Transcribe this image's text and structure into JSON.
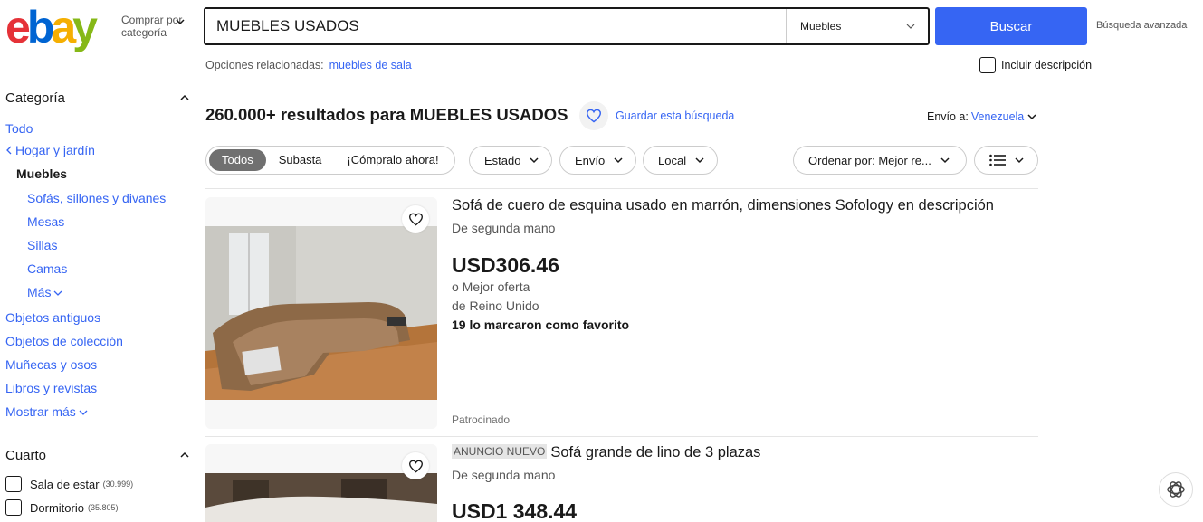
{
  "header": {
    "logo": [
      "e",
      "b",
      "a",
      "y"
    ],
    "shop_by_category": "Comprar por categoría",
    "search_value": "MUEBLES USADOS",
    "search_category": "Muebles",
    "search_button": "Buscar",
    "advanced_search": "Búsqueda avanzada",
    "related_label": "Opciones relacionadas:",
    "related_link": "muebles de sala",
    "include_description": "Incluir descripción"
  },
  "sidebar": {
    "category_title": "Categoría",
    "category_items": [
      {
        "label": "Todo"
      },
      {
        "label": "Hogar y jardín"
      },
      {
        "label": "Muebles"
      },
      {
        "label": "Sofás, sillones y divanes"
      },
      {
        "label": "Mesas"
      },
      {
        "label": "Sillas"
      },
      {
        "label": "Camas"
      },
      {
        "label": "Más"
      },
      {
        "label": "Objetos antiguos"
      },
      {
        "label": "Objetos de colección"
      },
      {
        "label": "Muñecas y osos"
      },
      {
        "label": "Libros y revistas"
      },
      {
        "label": "Mostrar más"
      }
    ],
    "room_title": "Cuarto",
    "room_items": [
      {
        "label": "Sala de estar",
        "count": "(30.999)"
      },
      {
        "label": "Dormitorio",
        "count": "(35.805)"
      }
    ]
  },
  "results": {
    "count_text": "260.000+ resultados para MUEBLES USADOS",
    "save_search": "Guardar esta búsqueda",
    "ship_to_label": "Envío a:",
    "ship_to_value": "Venezuela"
  },
  "filters": {
    "segments": [
      "Todos",
      "Subasta",
      "¡Cómpralo ahora!"
    ],
    "dropdowns": [
      "Estado",
      "Envío",
      "Local"
    ],
    "sort": "Ordenar por: Mejor re...",
    "view_icon": "list-view-icon"
  },
  "items": [
    {
      "badge": "",
      "title": "Sofá de cuero de esquina usado en marrón, dimensiones Sofology en descripción",
      "condition": "De segunda mano",
      "price": "USD306.46",
      "best_offer": "o Mejor oferta",
      "origin": "de Reino Unido",
      "watchers": "19 lo marcaron como favorito",
      "sponsored": "Patrocinado"
    },
    {
      "badge": "ANUNCIO NUEVO",
      "title": "Sofá grande de lino de 3 plazas",
      "condition": "De segunda mano",
      "price": "USD1 348.44"
    }
  ],
  "colors": {
    "accent": "#3665f3",
    "logo_e": "#e53238",
    "logo_b": "#0064d2",
    "logo_a": "#f5af02",
    "logo_y": "#86b817"
  }
}
